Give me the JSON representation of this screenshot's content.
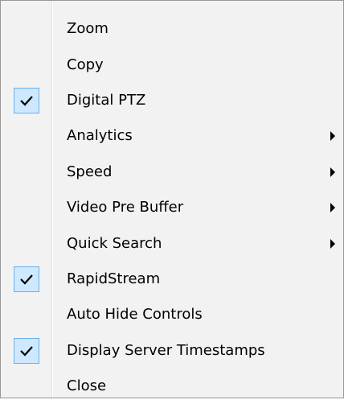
{
  "menu": {
    "items": [
      {
        "label": "Zoom",
        "checked": false,
        "submenu": false
      },
      {
        "label": "Copy",
        "checked": false,
        "submenu": false
      },
      {
        "label": "Digital PTZ",
        "checked": true,
        "submenu": false
      },
      {
        "label": "Analytics",
        "checked": false,
        "submenu": true
      },
      {
        "label": "Speed",
        "checked": false,
        "submenu": true
      },
      {
        "label": "Video Pre Buffer",
        "checked": false,
        "submenu": true
      },
      {
        "label": "Quick Search",
        "checked": false,
        "submenu": true
      },
      {
        "label": "RapidStream",
        "checked": true,
        "submenu": false
      },
      {
        "label": "Auto Hide Controls",
        "checked": false,
        "submenu": false
      },
      {
        "label": "Display Server Timestamps",
        "checked": true,
        "submenu": false
      },
      {
        "label": "Close",
        "checked": false,
        "submenu": false
      }
    ]
  },
  "icons": {
    "check": "checkmark-icon",
    "submenu": "submenu-arrow-icon"
  },
  "colors": {
    "menu_background": "#f2f2f2",
    "check_background": "#cde8ff",
    "check_border": "#6ab0e8",
    "check_mark": "#000000"
  }
}
